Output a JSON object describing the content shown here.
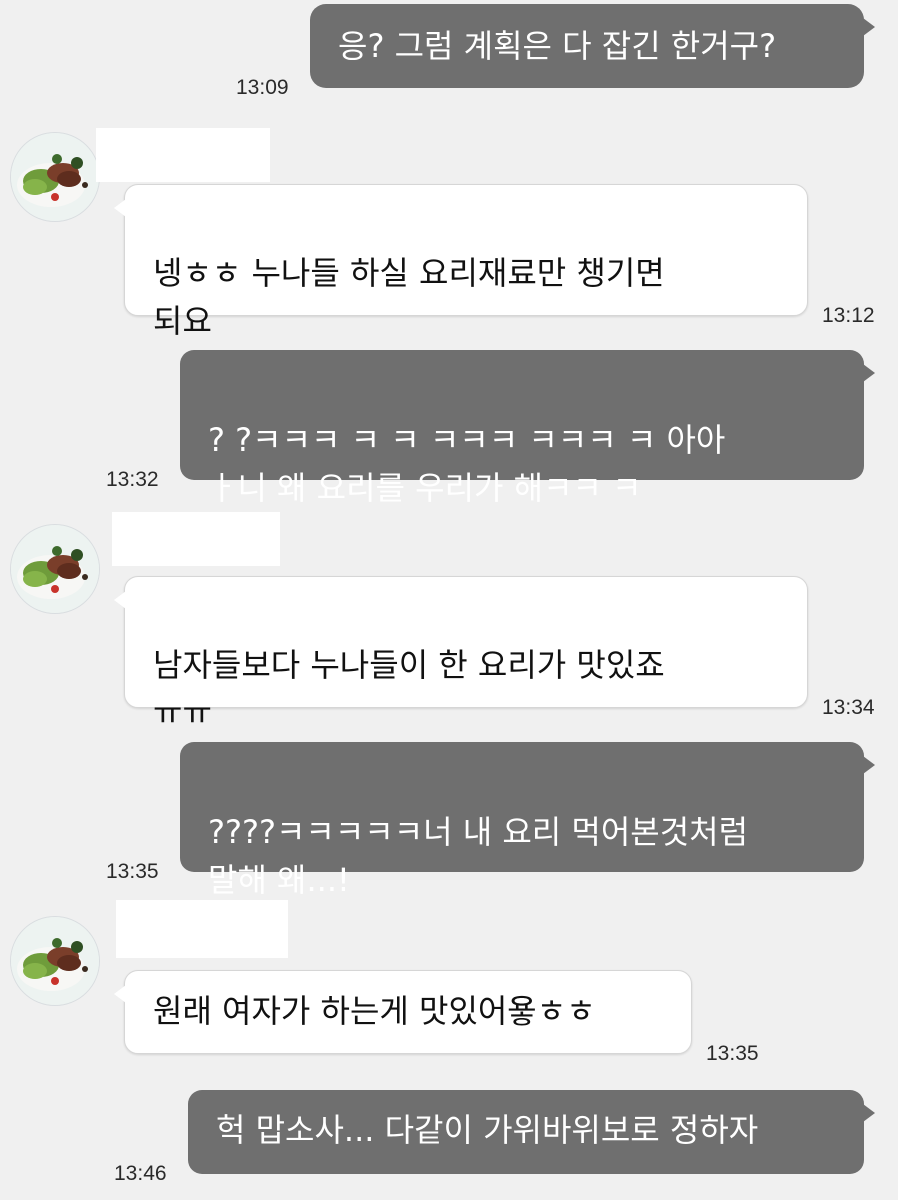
{
  "messages": [
    {
      "sender": "me",
      "text": "응? 그럼 계획은 다 잡긴 한거구?",
      "time": "13:09"
    },
    {
      "sender": "other",
      "text": "넹ㅎㅎ 누나들 하실 요리재료만 챙기면\n되요",
      "time": "13:12"
    },
    {
      "sender": "me",
      "text": "? ?ㅋㅋㅋ ㅋ  ㅋ ㅋㅋㅋ  ㅋㅋㅋ ㅋ 아아\nㅏ니 왜 요리를 우리가 해ㅋㅋ ㅋ",
      "time": "13:32"
    },
    {
      "sender": "other",
      "text": "남자들보다 누나들이 한 요리가 맛있죠\nㅠㅠ",
      "time": "13:34"
    },
    {
      "sender": "me",
      "text": "????ㅋㅋㅋㅋㅋ너 내 요리 먹어본것처럼\n말해 왜...!",
      "time": "13:35"
    },
    {
      "sender": "other",
      "text": "원래 여자가 하는게 맛있어욯ㅎㅎ",
      "time": "13:35"
    },
    {
      "sender": "me",
      "text": "헉 맙소사... 다같이 가위바위보로 정하자",
      "time": "13:46"
    }
  ],
  "colors": {
    "sent_bubble": "#6f6f6f",
    "received_bubble": "#ffffff",
    "background": "#f0f0f0"
  }
}
